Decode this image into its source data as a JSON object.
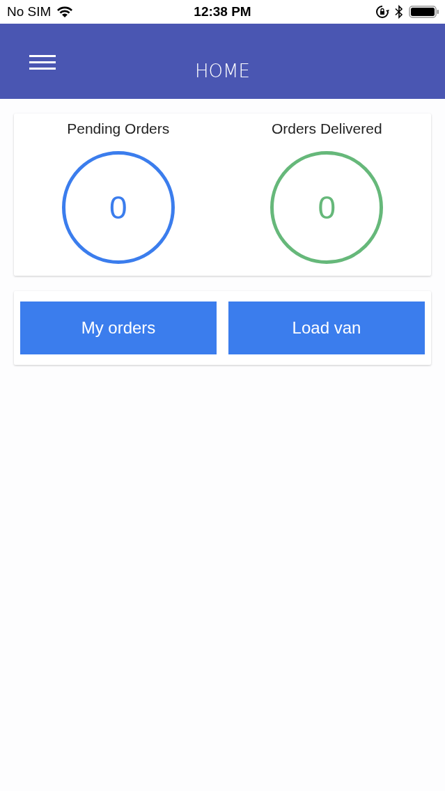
{
  "status_bar": {
    "carrier": "No SIM",
    "time": "12:38 PM"
  },
  "header": {
    "title": "HOME"
  },
  "counters": [
    {
      "label": "Pending Orders",
      "value": "0",
      "color": "#3b7ded"
    },
    {
      "label": "Orders Delivered",
      "value": "0",
      "color": "#66b87a"
    }
  ],
  "buttons": [
    "My orders",
    "Load van"
  ]
}
